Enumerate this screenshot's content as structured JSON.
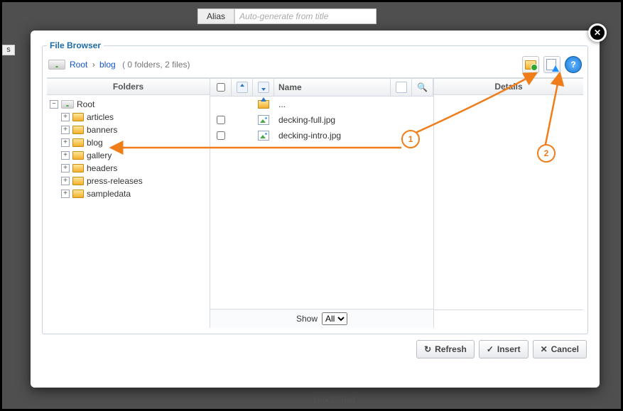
{
  "background": {
    "alias_label": "Alias",
    "alias_placeholder": "Auto-generate from title",
    "left_tab": "s",
    "bottom_text": "Link C Text"
  },
  "filebrowser": {
    "legend": "File Browser",
    "toolbar": {
      "new_folder_icon": "folder-new-icon",
      "upload_icon": "upload-icon",
      "help_icon": "help-icon"
    },
    "breadcrumb": {
      "root": "Root",
      "current": "blog",
      "stats": "( 0 folders, 2 files)"
    },
    "panes": {
      "folders_header": "Folders",
      "details_header": "Details",
      "name_header": "Name"
    },
    "tree": {
      "root_label": "Root",
      "children": [
        {
          "label": "articles"
        },
        {
          "label": "banners"
        },
        {
          "label": "blog"
        },
        {
          "label": "gallery"
        },
        {
          "label": "headers"
        },
        {
          "label": "press-releases"
        },
        {
          "label": "sampledata"
        }
      ]
    },
    "files": {
      "up_label": "...",
      "items": [
        {
          "name": "decking-full.jpg"
        },
        {
          "name": "decking-intro.jpg"
        }
      ]
    },
    "footer": {
      "show_label": "Show",
      "show_options": [
        "All"
      ],
      "show_value": "All"
    },
    "buttons": {
      "refresh": "Refresh",
      "insert": "Insert",
      "cancel": "Cancel"
    }
  },
  "annotations": {
    "label1": "1",
    "label2": "2"
  }
}
